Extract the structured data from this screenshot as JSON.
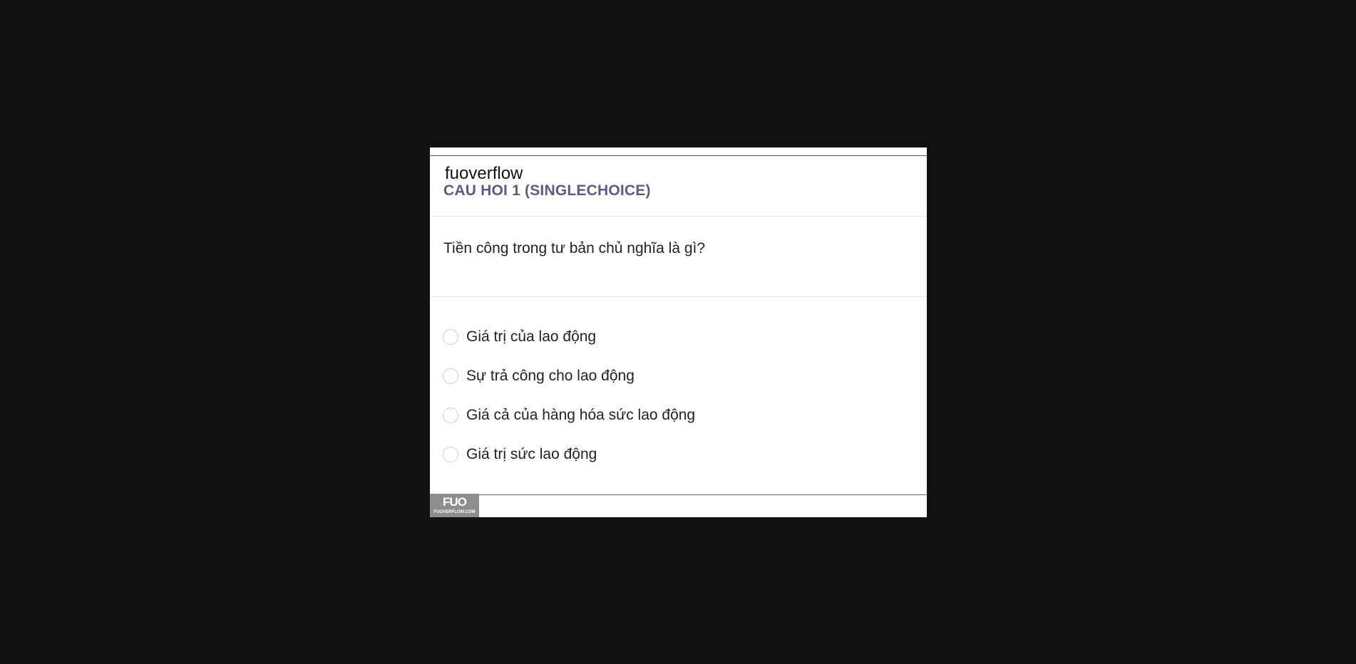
{
  "site_label": "fuoverflow",
  "question": {
    "heading": "CÂU HỎI 1 (SINGLECHOICE)",
    "text": "Tiền công trong tư bản chủ nghĩa là gì?"
  },
  "options": [
    {
      "label": "Giá trị của lao động",
      "selected": false
    },
    {
      "label": "Sự trả công cho lao động",
      "selected": false
    },
    {
      "label": "Giá cả của hàng hóa sức lao động",
      "selected": false
    },
    {
      "label": "Giá trị sức lao động",
      "selected": false
    }
  ],
  "footer_logo": {
    "mark": "FUO",
    "sub": "FUOVERFLOW.COM"
  },
  "colors": {
    "backdrop": "#111111",
    "heading": "#5b5b8a",
    "logo_bg": "#8e8e8e"
  }
}
